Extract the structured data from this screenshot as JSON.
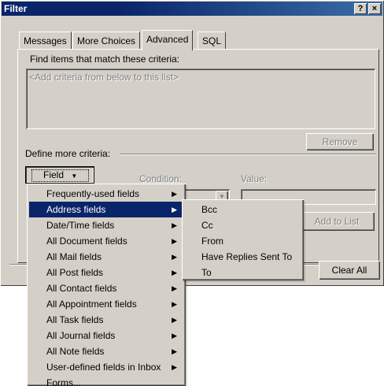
{
  "window": {
    "title": "Filter",
    "help_glyph": "?",
    "close_glyph": "×"
  },
  "tabs": [
    {
      "label": "Messages"
    },
    {
      "label": "More Choices"
    },
    {
      "label": "Advanced"
    },
    {
      "label": "SQL"
    }
  ],
  "active_tab": "Advanced",
  "criteria": {
    "find_label": "Find items that match these criteria:",
    "placeholder": "<Add criteria from below to this list>",
    "remove_label": "Remove"
  },
  "define": {
    "label": "Define more criteria:",
    "field_button": "Field",
    "condition_label": "Condition:",
    "value_label": "Value:",
    "add_to_list_label": "Add to List",
    "clear_all_label": "Clear All"
  },
  "field_menu": {
    "items": [
      {
        "label": "Frequently-used fields",
        "submenu": true
      },
      {
        "label": "Address fields",
        "submenu": true,
        "selected": true
      },
      {
        "label": "Date/Time fields",
        "submenu": true
      },
      {
        "label": "All Document fields",
        "submenu": true
      },
      {
        "label": "All Mail fields",
        "submenu": true
      },
      {
        "label": "All Post fields",
        "submenu": true
      },
      {
        "label": "All Contact fields",
        "submenu": true
      },
      {
        "label": "All Appointment fields",
        "submenu": true
      },
      {
        "label": "All Task fields",
        "submenu": true
      },
      {
        "label": "All Journal fields",
        "submenu": true
      },
      {
        "label": "All Note fields",
        "submenu": true
      },
      {
        "label": "User-defined fields in Inbox",
        "submenu": true
      },
      {
        "label": "Forms...",
        "submenu": false
      }
    ]
  },
  "address_submenu": {
    "items": [
      {
        "label": "Bcc"
      },
      {
        "label": "Cc"
      },
      {
        "label": "From"
      },
      {
        "label": "Have Replies Sent To"
      },
      {
        "label": "To"
      }
    ]
  },
  "colors": {
    "titlebar": "#0a246a",
    "face": "#d4d0c8",
    "highlight": "#0a246a"
  }
}
